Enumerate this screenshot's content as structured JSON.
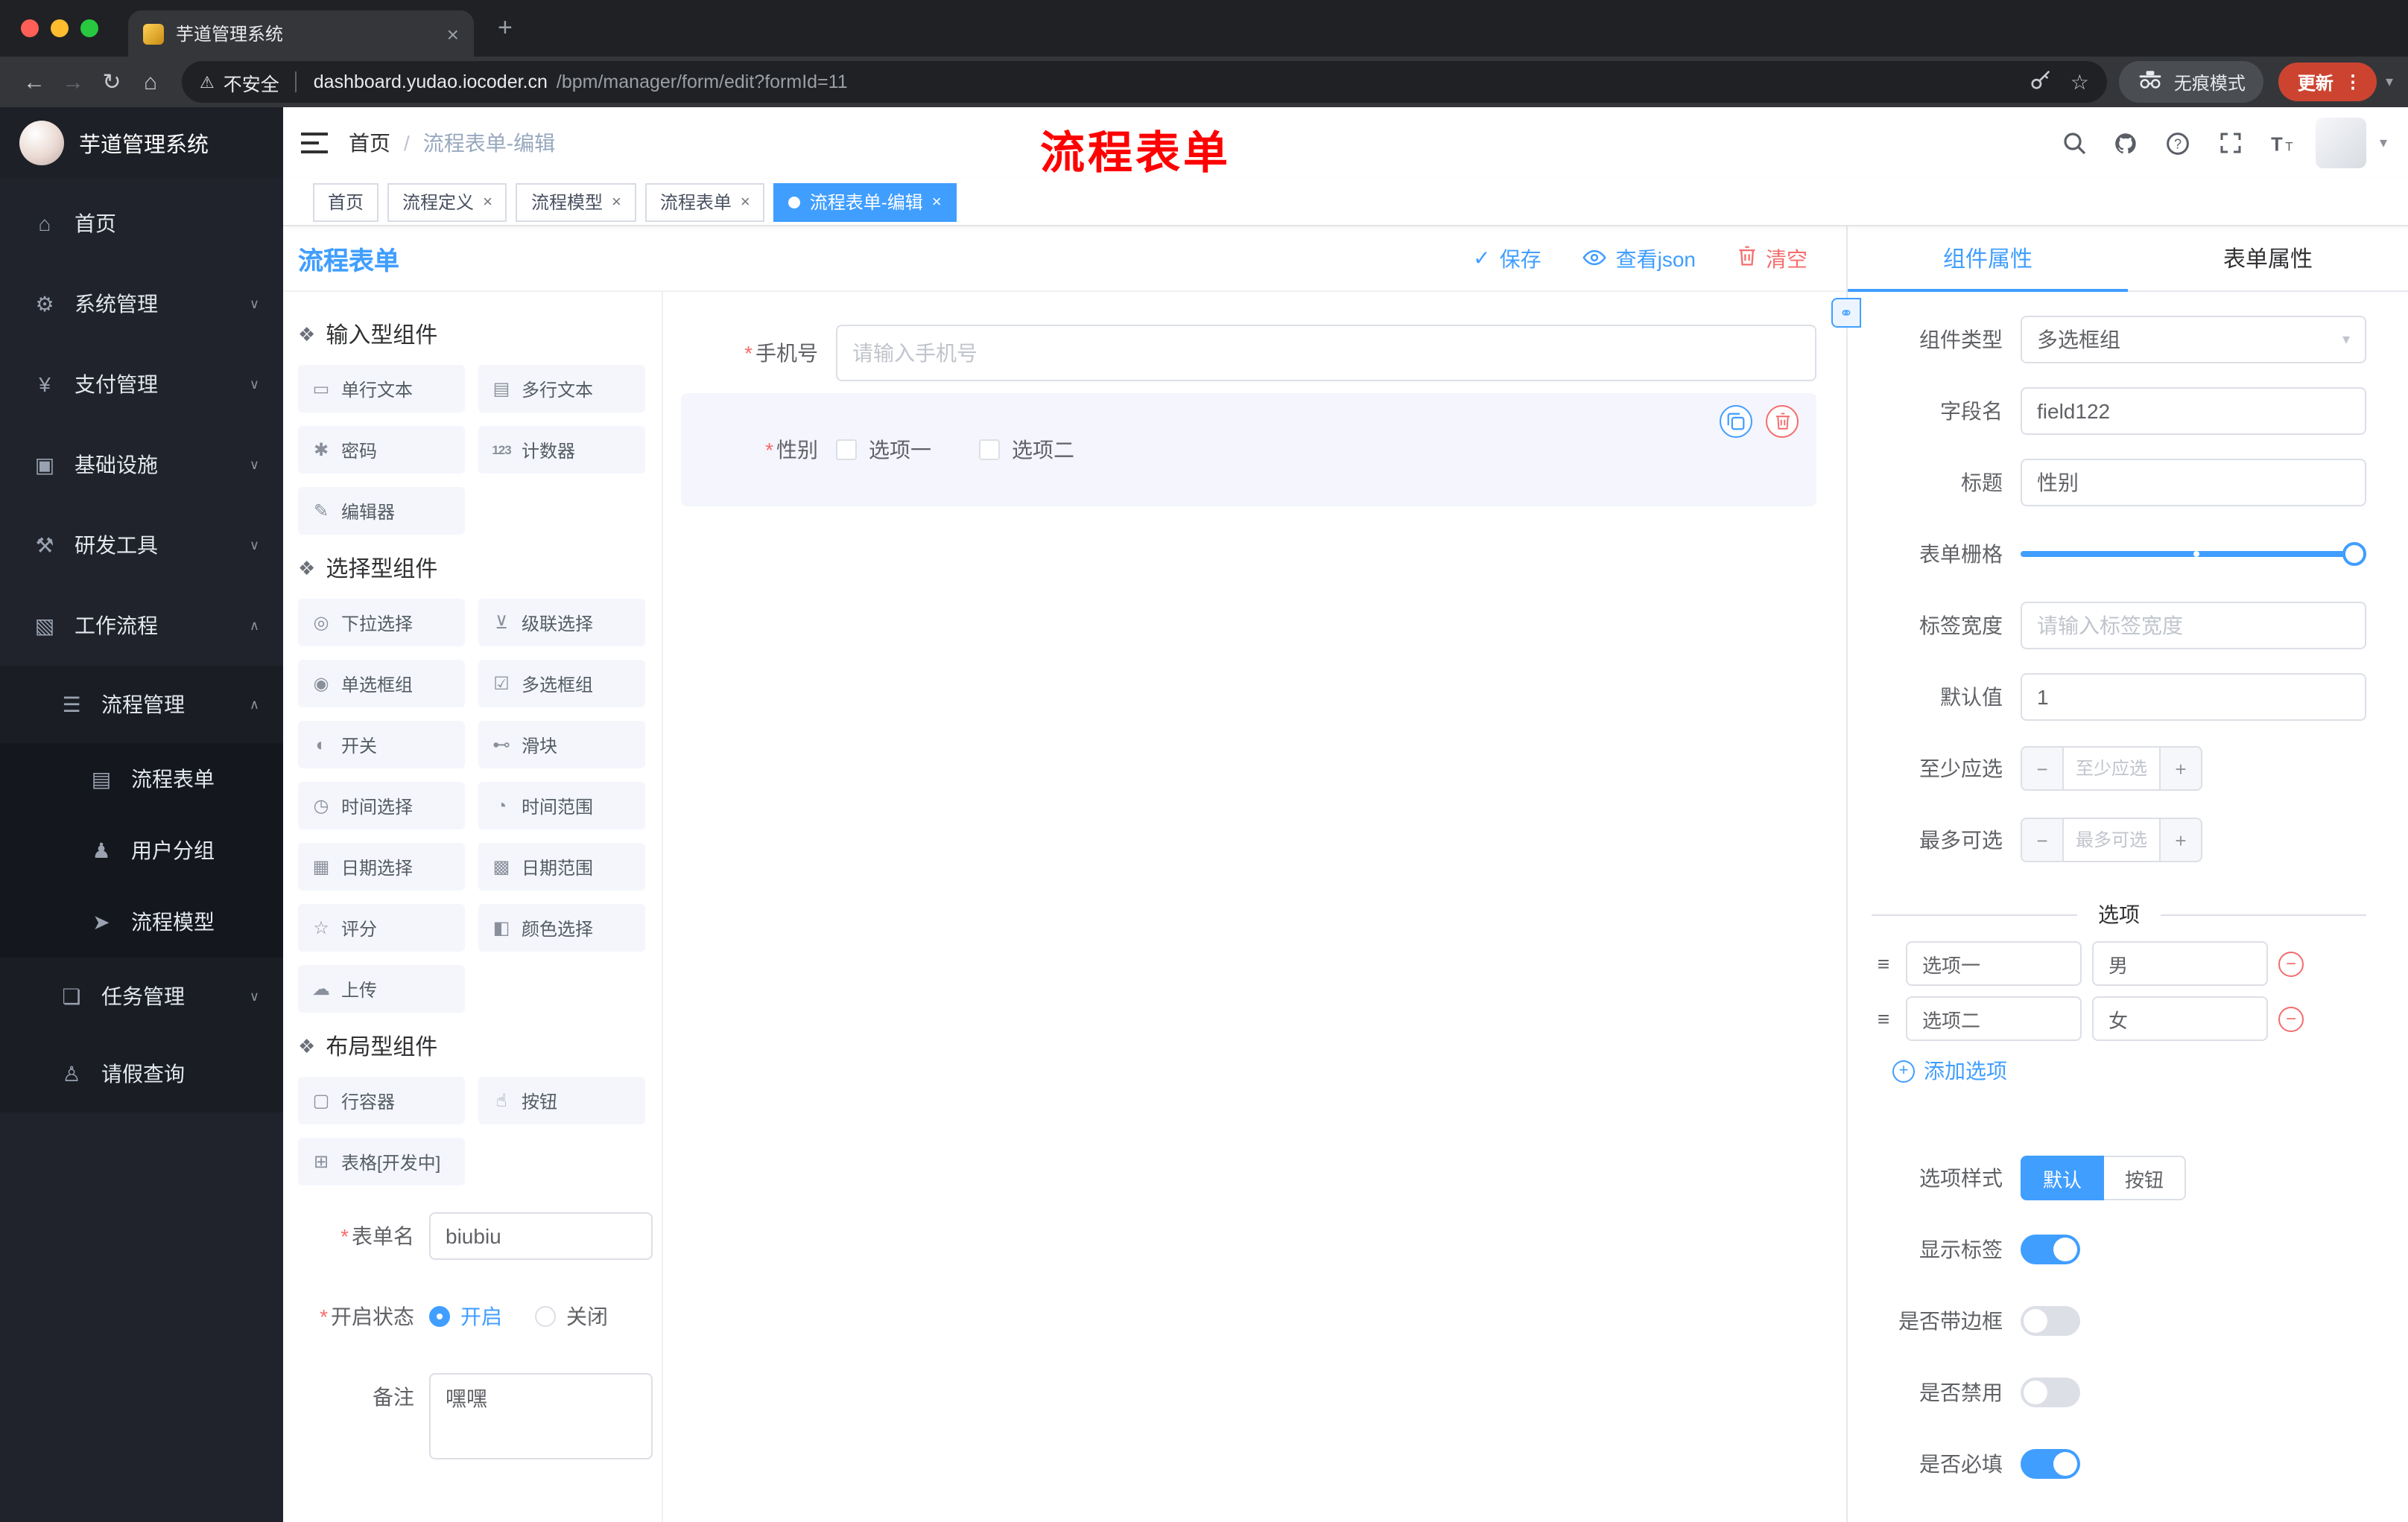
{
  "browser": {
    "tab_title": "芋道管理系统",
    "security_label": "不安全",
    "url_host": "dashboard.yudao.iocoder.cn",
    "url_path": "/bpm/manager/form/edit?formId=11",
    "incognito_label": "无痕模式",
    "update_label": "更新"
  },
  "icons": {
    "close": "×",
    "plus": "+",
    "back": "←",
    "forward": "→",
    "reload": "↻",
    "home": "⌂",
    "warning": "⚠",
    "star": "☆",
    "dots": "⋮",
    "caret_down": "▾",
    "check": "✓",
    "minus": "−",
    "drag": "≡",
    "link": "⚭",
    "required": "*",
    "slash": "/"
  },
  "sidebar": {
    "brand": "芋道管理系统",
    "items": [
      {
        "label": "首页",
        "glyph": "⌂",
        "chevron": ""
      },
      {
        "label": "系统管理",
        "glyph": "⚙",
        "chevron": "∨"
      },
      {
        "label": "支付管理",
        "glyph": "¥",
        "chevron": "∨"
      },
      {
        "label": "基础设施",
        "glyph": "▣",
        "chevron": "∨"
      },
      {
        "label": "研发工具",
        "glyph": "⚒",
        "chevron": "∨"
      },
      {
        "label": "工作流程",
        "glyph": "▧",
        "chevron": "∧"
      },
      {
        "label": "流程管理",
        "glyph": "☰",
        "chevron": "∧"
      },
      {
        "label": "流程表单",
        "glyph": "▤",
        "chevron": ""
      },
      {
        "label": "用户分组",
        "glyph": "♟",
        "chevron": ""
      },
      {
        "label": "流程模型",
        "glyph": "➤",
        "chevron": ""
      },
      {
        "label": "任务管理",
        "glyph": "❏",
        "chevron": "∨"
      },
      {
        "label": "请假查询",
        "glyph": "♙",
        "chevron": ""
      }
    ]
  },
  "header": {
    "breadcrumb": [
      "首页",
      "流程表单-编辑"
    ],
    "overlay_title": "流程表单"
  },
  "tags": [
    {
      "label": "首页",
      "closable": false,
      "active": false
    },
    {
      "label": "流程定义",
      "closable": true,
      "active": false
    },
    {
      "label": "流程模型",
      "closable": true,
      "active": false
    },
    {
      "label": "流程表单",
      "closable": true,
      "active": false
    },
    {
      "label": "流程表单-编辑",
      "closable": true,
      "active": true
    }
  ],
  "page": {
    "title": "流程表单",
    "save": "保存",
    "view_json": "查看json",
    "clear": "清空"
  },
  "palette": {
    "sections": [
      {
        "title": "输入型组件",
        "items": [
          {
            "label": "单行文本",
            "glyph": "▭"
          },
          {
            "label": "多行文本",
            "glyph": "▤"
          },
          {
            "label": "密码",
            "glyph": "✱"
          },
          {
            "label": "计数器",
            "glyph": "123"
          },
          {
            "label": "编辑器",
            "glyph": "✎"
          }
        ]
      },
      {
        "title": "选择型组件",
        "items": [
          {
            "label": "下拉选择",
            "glyph": "◎"
          },
          {
            "label": "级联选择",
            "glyph": "⊻"
          },
          {
            "label": "单选框组",
            "glyph": "◉"
          },
          {
            "label": "多选框组",
            "glyph": "☑"
          },
          {
            "label": "开关",
            "glyph": "◐"
          },
          {
            "label": "滑块",
            "glyph": "⊷"
          },
          {
            "label": "时间选择",
            "glyph": "◷"
          },
          {
            "label": "时间范围",
            "glyph": "◔"
          },
          {
            "label": "日期选择",
            "glyph": "▦"
          },
          {
            "label": "日期范围",
            "glyph": "▩"
          },
          {
            "label": "评分",
            "glyph": "☆"
          },
          {
            "label": "颜色选择",
            "glyph": "◧"
          },
          {
            "label": "上传",
            "glyph": "☁"
          }
        ]
      },
      {
        "title": "布局型组件",
        "items": [
          {
            "label": "行容器",
            "glyph": "▢"
          },
          {
            "label": "按钮",
            "glyph": "☝"
          },
          {
            "label": "表格[开发中]",
            "glyph": "⊞"
          }
        ]
      }
    ],
    "form": {
      "name_label": "表单名",
      "name_value": "biubiu",
      "status_label": "开启状态",
      "status_on": "开启",
      "status_off": "关闭",
      "status_on_selected": true,
      "remark_label": "备注",
      "remark_value": "嘿嘿"
    }
  },
  "canvas": {
    "phone": {
      "label": "手机号",
      "placeholder": "请输入手机号"
    },
    "gender": {
      "label": "性别",
      "options": [
        "选项一",
        "选项二"
      ]
    }
  },
  "props": {
    "tabs": [
      "组件属性",
      "表单属性"
    ],
    "component_type_label": "组件类型",
    "component_type_value": "多选框组",
    "field_name_label": "字段名",
    "field_name_value": "field122",
    "title_label": "标题",
    "title_value": "性别",
    "grid_label": "表单栅格",
    "label_width_label": "标签宽度",
    "label_width_placeholder": "请输入标签宽度",
    "default_label": "默认值",
    "default_value": "1",
    "min_label": "至少应选",
    "min_placeholder": "至少应选",
    "max_label": "最多可选",
    "max_placeholder": "最多可选",
    "options_title": "选项",
    "options": [
      {
        "label": "选项一",
        "value": "男"
      },
      {
        "label": "选项二",
        "value": "女"
      }
    ],
    "add_option": "添加选项",
    "style_label": "选项样式",
    "style_options": [
      "默认",
      "按钮"
    ],
    "style_default_active": true,
    "toggles": [
      {
        "label": "显示标签",
        "on": true
      },
      {
        "label": "是否带边框",
        "on": false
      },
      {
        "label": "是否禁用",
        "on": false
      },
      {
        "label": "是否必填",
        "on": true
      }
    ]
  },
  "colors": {
    "accent": "#409eff",
    "danger": "#f56c6c",
    "annotation_red": "#ff0000",
    "update_button": "#cc4430",
    "sidebar_bg": "#20232b"
  }
}
